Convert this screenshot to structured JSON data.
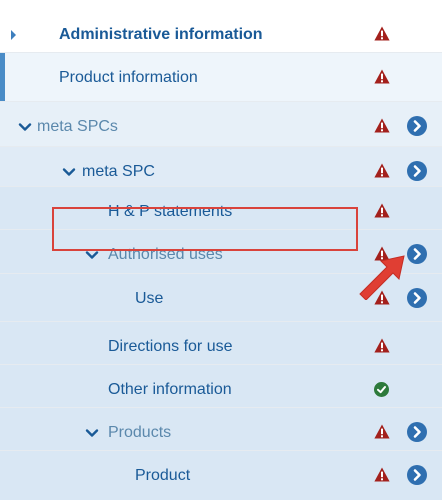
{
  "tree": {
    "items": [
      {
        "label": "Administrative information",
        "status": "warning",
        "expander": "collapsed",
        "navigate": false
      },
      {
        "label": "Product information",
        "status": "warning",
        "expander": "none",
        "navigate": false,
        "selected": true
      },
      {
        "label": "meta SPCs",
        "status": "warning",
        "expander": "expanded",
        "navigate": true
      },
      {
        "label": "meta SPC",
        "status": "warning",
        "expander": "expanded",
        "navigate": true
      },
      {
        "label": "H & P statements",
        "status": "warning",
        "expander": "none",
        "navigate": false
      },
      {
        "label": "Authorised uses",
        "status": "warning",
        "expander": "expanded",
        "navigate": true,
        "highlighted": true
      },
      {
        "label": "Use",
        "status": "warning",
        "expander": "none",
        "navigate": true
      },
      {
        "label": "Directions for use",
        "status": "warning",
        "expander": "none",
        "navigate": false
      },
      {
        "label": "Other information",
        "status": "ok",
        "expander": "none",
        "navigate": false
      },
      {
        "label": "Products",
        "status": "warning",
        "expander": "expanded",
        "navigate": true
      },
      {
        "label": "Product",
        "status": "warning",
        "expander": "none",
        "navigate": true
      }
    ]
  },
  "icons": {
    "warning": "warning-triangle-icon",
    "ok": "check-circle-icon",
    "navigate": "chevron-right-circle-icon",
    "expanded": "chevron-down-icon",
    "collapsed": "caret-right-icon"
  },
  "colors": {
    "text": "#1a5a97",
    "text_muted": "#5b88ac",
    "accent": "#2f6fb0",
    "warning": "#a3201c",
    "ok": "#2d7a3b",
    "highlight": "#d9433b",
    "pointer": "#e03e33",
    "selected_bar": "#4a8cc7"
  }
}
